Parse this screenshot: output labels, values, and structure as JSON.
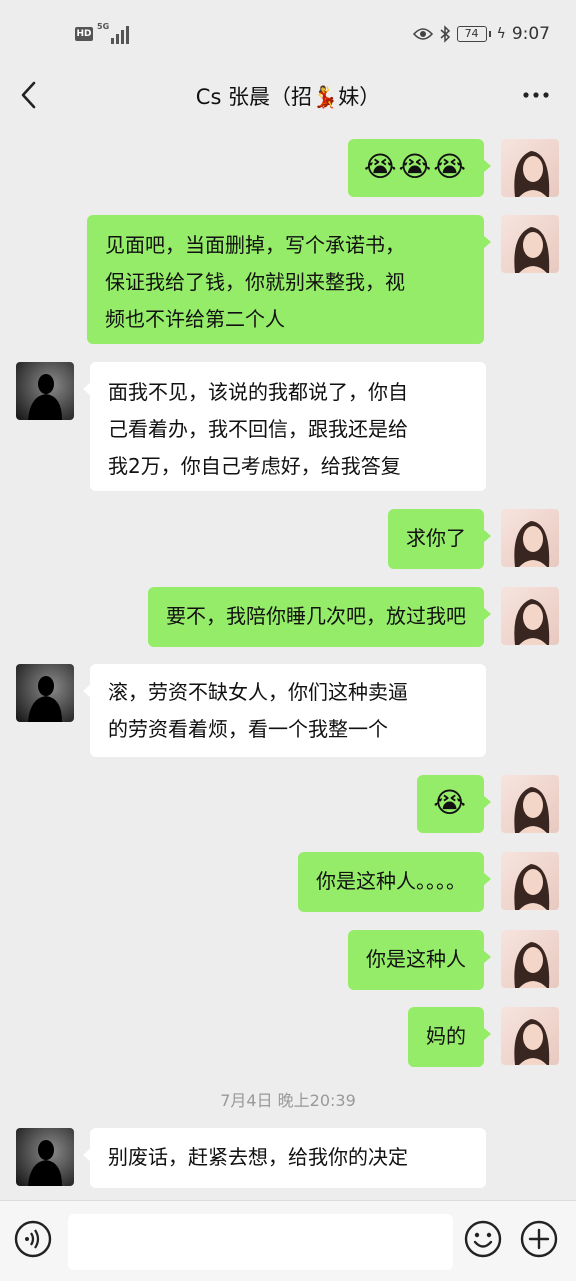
{
  "status_bar": {
    "hd": "HD",
    "network": "5G",
    "battery": "74",
    "time": "9:07"
  },
  "header": {
    "title": "Cs 张晨（招💃妹）"
  },
  "messages": [
    {
      "sender": "me",
      "text": "😭😭😭"
    },
    {
      "sender": "me",
      "text": "见面吧，当面删掉，写个承诺书，\n保证我给了钱，你就别来整我，视\n频也不许给第二个人"
    },
    {
      "sender": "them",
      "text": "面我不见，该说的我都说了，你自\n己看着办，我不回信，跟我还是给\n我2万，你自己考虑好，给我答复"
    },
    {
      "sender": "me",
      "text": "求你了"
    },
    {
      "sender": "me",
      "text": "要不，我陪你睡几次吧，放过我吧"
    },
    {
      "sender": "them",
      "text": "滚，劳资不缺女人，你们这种卖逼\n的劳资看着烦，看一个我整一个"
    },
    {
      "sender": "me",
      "text": "😭"
    },
    {
      "sender": "me",
      "text": "你是这种人。。。。"
    },
    {
      "sender": "me",
      "text": "你是这种人"
    },
    {
      "sender": "me",
      "text": "妈的"
    },
    {
      "sender": "them",
      "text": "别废话，赶紧去想，给我你的决定"
    }
  ],
  "timestamp": "7月4日 晚上20:39",
  "input": {
    "placeholder": ""
  },
  "colors": {
    "background": "#ededed",
    "my_bubble": "#95ec69",
    "their_bubble": "#ffffff"
  }
}
